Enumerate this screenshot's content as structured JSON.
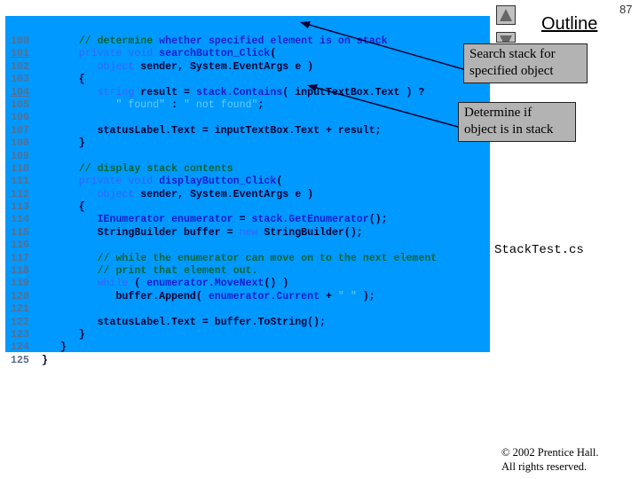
{
  "slide": {
    "page_number": "87",
    "outline_title": "Outline",
    "file_name": "StackTest.cs",
    "copyright_line1": "© 2002 Prentice Hall.",
    "copyright_line2": "All rights reserved.",
    "nav": {
      "up_icon": "triangle-up-icon",
      "down_icon": "triangle-down-icon"
    }
  },
  "callouts": [
    {
      "line1": "Search stack for",
      "line2": "specified object"
    },
    {
      "line1": "Determine if",
      "line2": "object is in stack"
    }
  ],
  "colors": {
    "code_background": "#0099ff",
    "callout_background": "#b3b3b3",
    "keyword": "#3366ff",
    "comment": "#006633",
    "string": "#66ccff",
    "line_number": "#5a6e8c"
  },
  "code": {
    "lines": [
      {
        "num": "100",
        "u": false,
        "tokens": [
          [
            "plain",
            "       "
          ],
          [
            "cm",
            "// determine"
          ],
          [
            "cmb",
            " whether specified element is on stack"
          ]
        ]
      },
      {
        "num": "101",
        "u": true,
        "tokens": [
          [
            "plain",
            "       "
          ],
          [
            "kw",
            "private void"
          ],
          [
            "id",
            " searchButton_Click"
          ],
          [
            "plain",
            "("
          ]
        ]
      },
      {
        "num": "102",
        "u": false,
        "tokens": [
          [
            "plain",
            "          "
          ],
          [
            "kw",
            "object"
          ],
          [
            "plain",
            " sender, System.EventArgs e )"
          ]
        ]
      },
      {
        "num": "103",
        "u": false,
        "tokens": [
          [
            "plain",
            "       {"
          ]
        ]
      },
      {
        "num": "104",
        "u": true,
        "tokens": [
          [
            "plain",
            "          "
          ],
          [
            "kw",
            "string"
          ],
          [
            "plain",
            " result = "
          ],
          [
            "id",
            "stack.Contains"
          ],
          [
            "plain",
            "( inputTextBox.Text ) ?"
          ]
        ]
      },
      {
        "num": "105",
        "u": false,
        "tokens": [
          [
            "plain",
            "             "
          ],
          [
            "str",
            "\" found\""
          ],
          [
            "plain",
            " : "
          ],
          [
            "str",
            "\" not found\""
          ],
          [
            "plain",
            ";"
          ]
        ]
      },
      {
        "num": "106",
        "u": false,
        "tokens": []
      },
      {
        "num": "107",
        "u": false,
        "tokens": [
          [
            "plain",
            "          statusLabel.Text = inputTextBox.Text + result;"
          ]
        ]
      },
      {
        "num": "108",
        "u": false,
        "tokens": [
          [
            "plain",
            "       }"
          ]
        ]
      },
      {
        "num": "109",
        "u": false,
        "tokens": []
      },
      {
        "num": "110",
        "u": false,
        "tokens": [
          [
            "plain",
            "       "
          ],
          [
            "cm",
            "// display stack contents"
          ]
        ]
      },
      {
        "num": "111",
        "u": false,
        "tokens": [
          [
            "plain",
            "       "
          ],
          [
            "kw",
            "private void"
          ],
          [
            "id",
            " displayButton_Click"
          ],
          [
            "plain",
            "("
          ]
        ]
      },
      {
        "num": "112",
        "u": false,
        "tokens": [
          [
            "plain",
            "          "
          ],
          [
            "kw",
            "object"
          ],
          [
            "plain",
            " sender, System.EventArgs e )"
          ]
        ]
      },
      {
        "num": "113",
        "u": false,
        "tokens": [
          [
            "plain",
            "       {"
          ]
        ]
      },
      {
        "num": "114",
        "u": false,
        "tokens": [
          [
            "plain",
            "          "
          ],
          [
            "id",
            "IEnumerator enumerator"
          ],
          [
            "plain",
            " = "
          ],
          [
            "id",
            "stack.GetEnumerator"
          ],
          [
            "plain",
            "();"
          ]
        ]
      },
      {
        "num": "115",
        "u": false,
        "tokens": [
          [
            "plain",
            "          StringBuilder buffer = "
          ],
          [
            "kw",
            "new"
          ],
          [
            "plain",
            " StringBuilder();"
          ]
        ]
      },
      {
        "num": "116",
        "u": false,
        "tokens": []
      },
      {
        "num": "117",
        "u": false,
        "tokens": [
          [
            "plain",
            "          "
          ],
          [
            "cm",
            "// while the enumerator can move on to the next element"
          ]
        ]
      },
      {
        "num": "118",
        "u": false,
        "tokens": [
          [
            "plain",
            "          "
          ],
          [
            "cm",
            "// print that element out."
          ]
        ]
      },
      {
        "num": "119",
        "u": false,
        "tokens": [
          [
            "plain",
            "          "
          ],
          [
            "kw",
            "while"
          ],
          [
            "plain",
            " ( "
          ],
          [
            "id",
            "enumerator.MoveNext"
          ],
          [
            "plain",
            "() )"
          ]
        ]
      },
      {
        "num": "120",
        "u": false,
        "tokens": [
          [
            "plain",
            "             buffer.Append( "
          ],
          [
            "id",
            "enumerator.Current"
          ],
          [
            "plain",
            " + "
          ],
          [
            "str",
            "\" \""
          ],
          [
            "plain",
            " );"
          ]
        ]
      },
      {
        "num": "121",
        "u": false,
        "tokens": []
      },
      {
        "num": "122",
        "u": false,
        "tokens": [
          [
            "plain",
            "          statusLabel.Text = buffer.ToString();"
          ]
        ]
      },
      {
        "num": "123",
        "u": false,
        "tokens": [
          [
            "plain",
            "       }"
          ]
        ]
      },
      {
        "num": "124",
        "u": false,
        "tokens": [
          [
            "plain",
            "    }"
          ]
        ]
      },
      {
        "num": "125",
        "u": false,
        "tokens": [
          [
            "plain",
            " }"
          ]
        ]
      }
    ]
  }
}
